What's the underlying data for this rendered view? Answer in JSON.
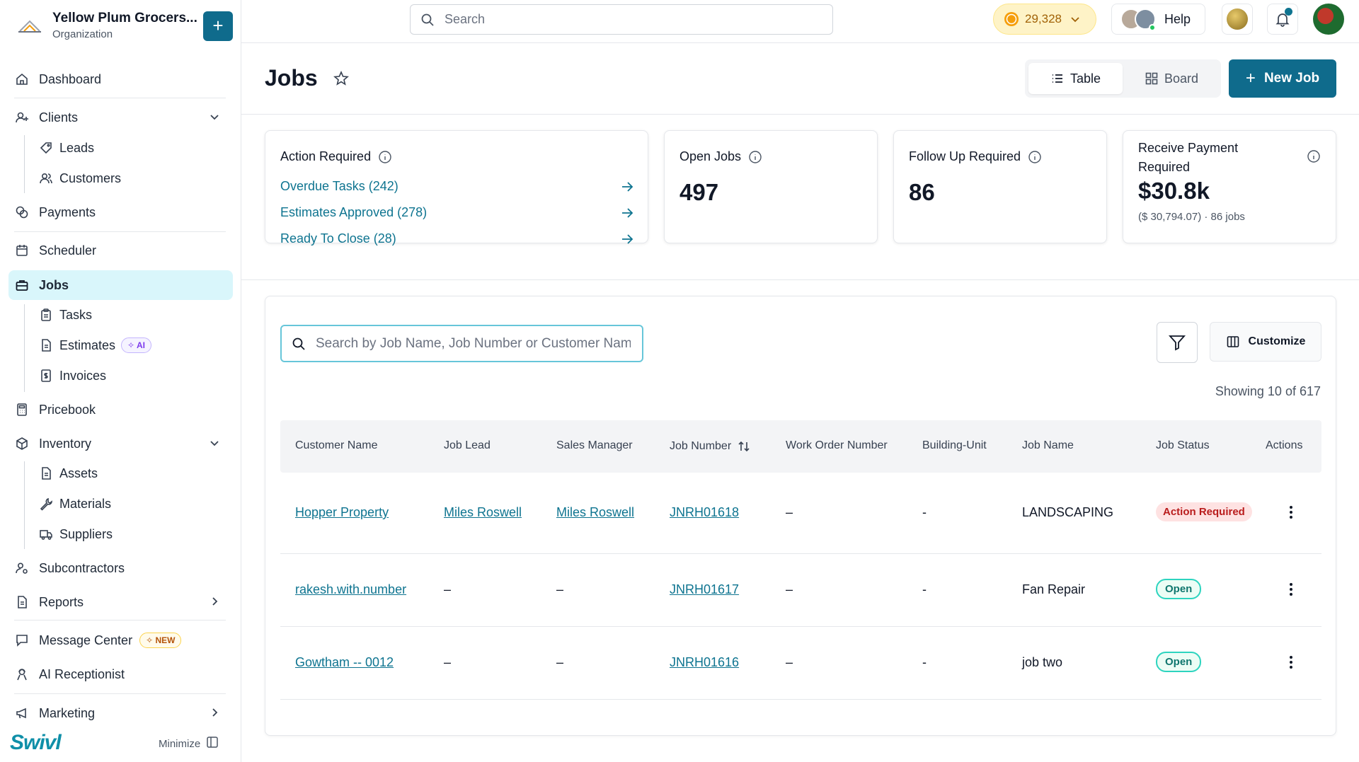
{
  "org": {
    "name": "Yellow Plum Grocers...",
    "subtitle": "Organization",
    "add_label": "+"
  },
  "sidebar": {
    "items": [
      {
        "label": "Dashboard"
      },
      {
        "label": "Clients"
      },
      {
        "label": "Leads"
      },
      {
        "label": "Customers"
      },
      {
        "label": "Payments"
      },
      {
        "label": "Scheduler"
      },
      {
        "label": "Jobs"
      },
      {
        "label": "Tasks"
      },
      {
        "label": "Estimates",
        "badge": "AI"
      },
      {
        "label": "Invoices"
      },
      {
        "label": "Pricebook"
      },
      {
        "label": "Inventory"
      },
      {
        "label": "Assets"
      },
      {
        "label": "Materials"
      },
      {
        "label": "Suppliers"
      },
      {
        "label": "Subcontractors"
      },
      {
        "label": "Reports"
      },
      {
        "label": "Message Center",
        "badge": "NEW"
      },
      {
        "label": "AI Receptionist"
      },
      {
        "label": "Marketing"
      }
    ],
    "active": "Jobs",
    "brand": "Swivl",
    "minimize_label": "Minimize"
  },
  "topbar": {
    "search_placeholder": "Search",
    "coins": "29,328",
    "help_label": "Help"
  },
  "page": {
    "title": "Jobs",
    "view_table": "Table",
    "view_board": "Board",
    "active_view": "Table",
    "new_job_label": "New Job"
  },
  "stats": {
    "action_required": {
      "title": "Action Required",
      "links": [
        {
          "label": "Overdue Tasks (242)"
        },
        {
          "label": "Estimates Approved (278)"
        },
        {
          "label": "Ready To Close (28)"
        }
      ]
    },
    "open_jobs": {
      "title": "Open Jobs",
      "value": "497"
    },
    "follow_up": {
      "title": "Follow Up Required",
      "value": "86"
    },
    "receive_payment": {
      "title_line1": "Receive Payment",
      "title_line2": "Required",
      "value": "$30.8k",
      "detail": "($ 30,794.07) · 86 jobs"
    }
  },
  "table": {
    "search_placeholder": "Search by Job Name, Job Number or Customer Name",
    "customize_label": "Customize",
    "showing": "Showing 10 of 617",
    "columns": [
      "Customer Name",
      "Job Lead",
      "Sales Manager",
      "Job Number",
      "Work Order Number",
      "Building-Unit",
      "Job Name",
      "Job Status",
      "Actions"
    ],
    "rows": [
      {
        "customer": "Hopper Property",
        "lead": "Miles Roswell",
        "sales": "Miles Roswell",
        "number": "JNRH01618",
        "work_order": "–",
        "building": "-",
        "job_name": "LANDSCAPING",
        "status": "Action Required"
      },
      {
        "customer": "rakesh.with.number",
        "lead": "–",
        "sales": "–",
        "number": "JNRH01617",
        "work_order": "–",
        "building": "-",
        "job_name": "Fan Repair",
        "status": "Open"
      },
      {
        "customer": "Gowtham -- 0012",
        "lead": "–",
        "sales": "–",
        "number": "JNRH01616",
        "work_order": "–",
        "building": "-",
        "job_name": "job two",
        "status": "Open"
      }
    ]
  },
  "colors": {
    "accent": "#0f6b8c",
    "link": "#0e7490",
    "active_nav_bg": "#d9f6fb",
    "status_red": "#b91c1c",
    "status_open": "#0f766e"
  }
}
